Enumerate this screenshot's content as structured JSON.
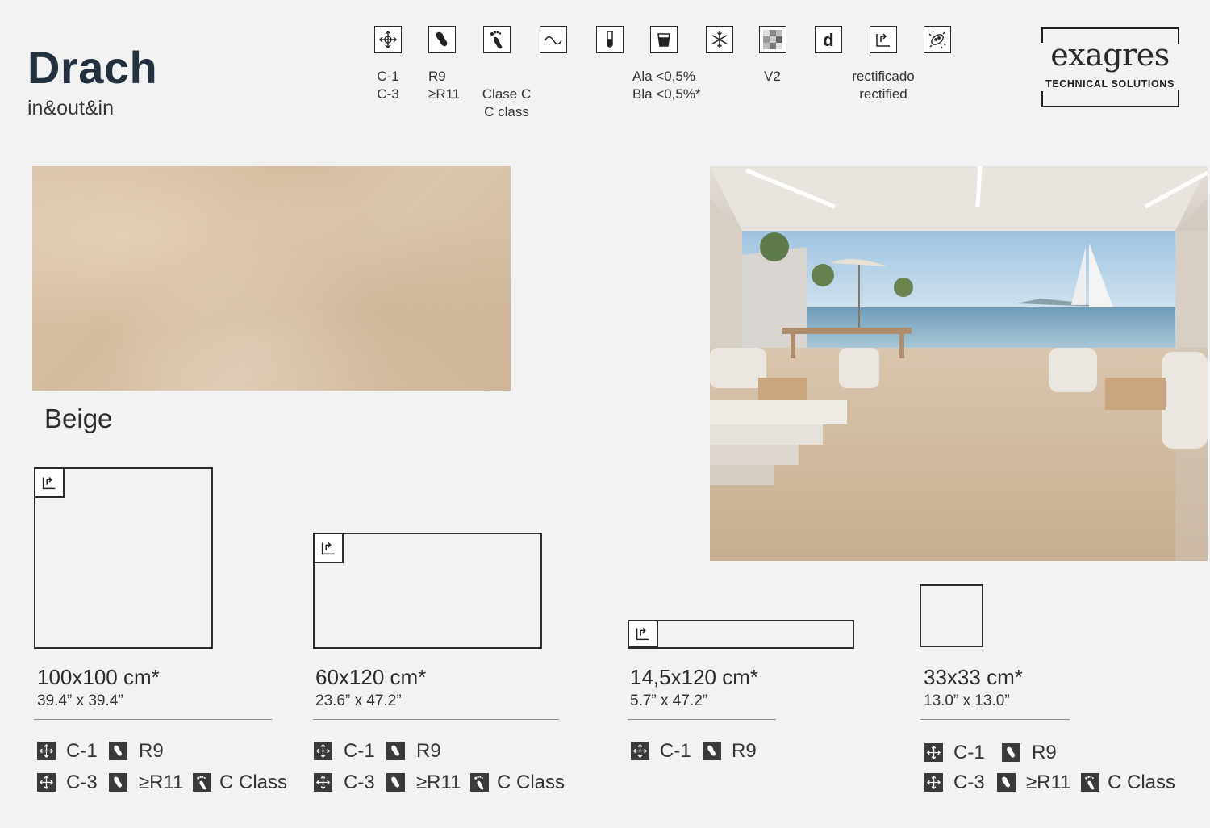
{
  "product": {
    "name": "Drach",
    "line": "in&out&in"
  },
  "specs": [
    {
      "icon": "move-arrows-icon",
      "lines": [
        "C-1",
        "C-3"
      ]
    },
    {
      "icon": "shoe-sole-icon",
      "lines": [
        "R9",
        "≥R11"
      ]
    },
    {
      "icon": "bare-foot-icon",
      "lines": [
        "Clase C",
        "C class"
      ]
    },
    {
      "icon": "wave-icon",
      "lines": []
    },
    {
      "icon": "test-tube-icon",
      "lines": []
    },
    {
      "icon": "water-cup-icon",
      "lines": [
        "Ala <0,5%",
        "Bla <0,5%*"
      ]
    },
    {
      "icon": "snowflake-icon",
      "lines": []
    },
    {
      "icon": "shade-variation-icon",
      "lines": [
        "V2"
      ]
    },
    {
      "icon": "d-letter-icon",
      "lines": []
    },
    {
      "icon": "rectified-edge-icon",
      "lines": [
        "rectificado",
        "rectified"
      ]
    },
    {
      "icon": "bacteria-icon",
      "lines": []
    }
  ],
  "brand": {
    "name": "exagres",
    "tagline": "TECHNICAL SOLUTIONS"
  },
  "color": {
    "name": "Beige",
    "swatch_hex": "#d6bea3"
  },
  "formats": [
    {
      "metric": "100x100 cm*",
      "imperial": "39.4” x 39.4”",
      "rectified": true,
      "rows": [
        [
          "C-1",
          "R9"
        ],
        [
          "C-3",
          "≥R11",
          "C Class"
        ]
      ]
    },
    {
      "metric": "60x120 cm*",
      "imperial": "23.6” x 47.2”",
      "rectified": true,
      "rows": [
        [
          "C-1",
          "R9"
        ],
        [
          "C-3",
          "≥R11",
          "C Class"
        ]
      ]
    },
    {
      "metric": "14,5x120 cm*",
      "imperial": "5.7” x 47.2”",
      "rectified": true,
      "rows": [
        [
          "C-1",
          "R9"
        ]
      ]
    },
    {
      "metric": "33x33 cm*",
      "imperial": "13.0” x 13.0”",
      "rectified": false,
      "rows": [
        [
          "C-1",
          "R9"
        ],
        [
          "C-3",
          "≥R11",
          "C Class"
        ]
      ]
    }
  ],
  "colors": {
    "text": "#2b2b2b",
    "title": "#233040",
    "background": "#f2f2f2",
    "badge": "#3a3a3a"
  }
}
